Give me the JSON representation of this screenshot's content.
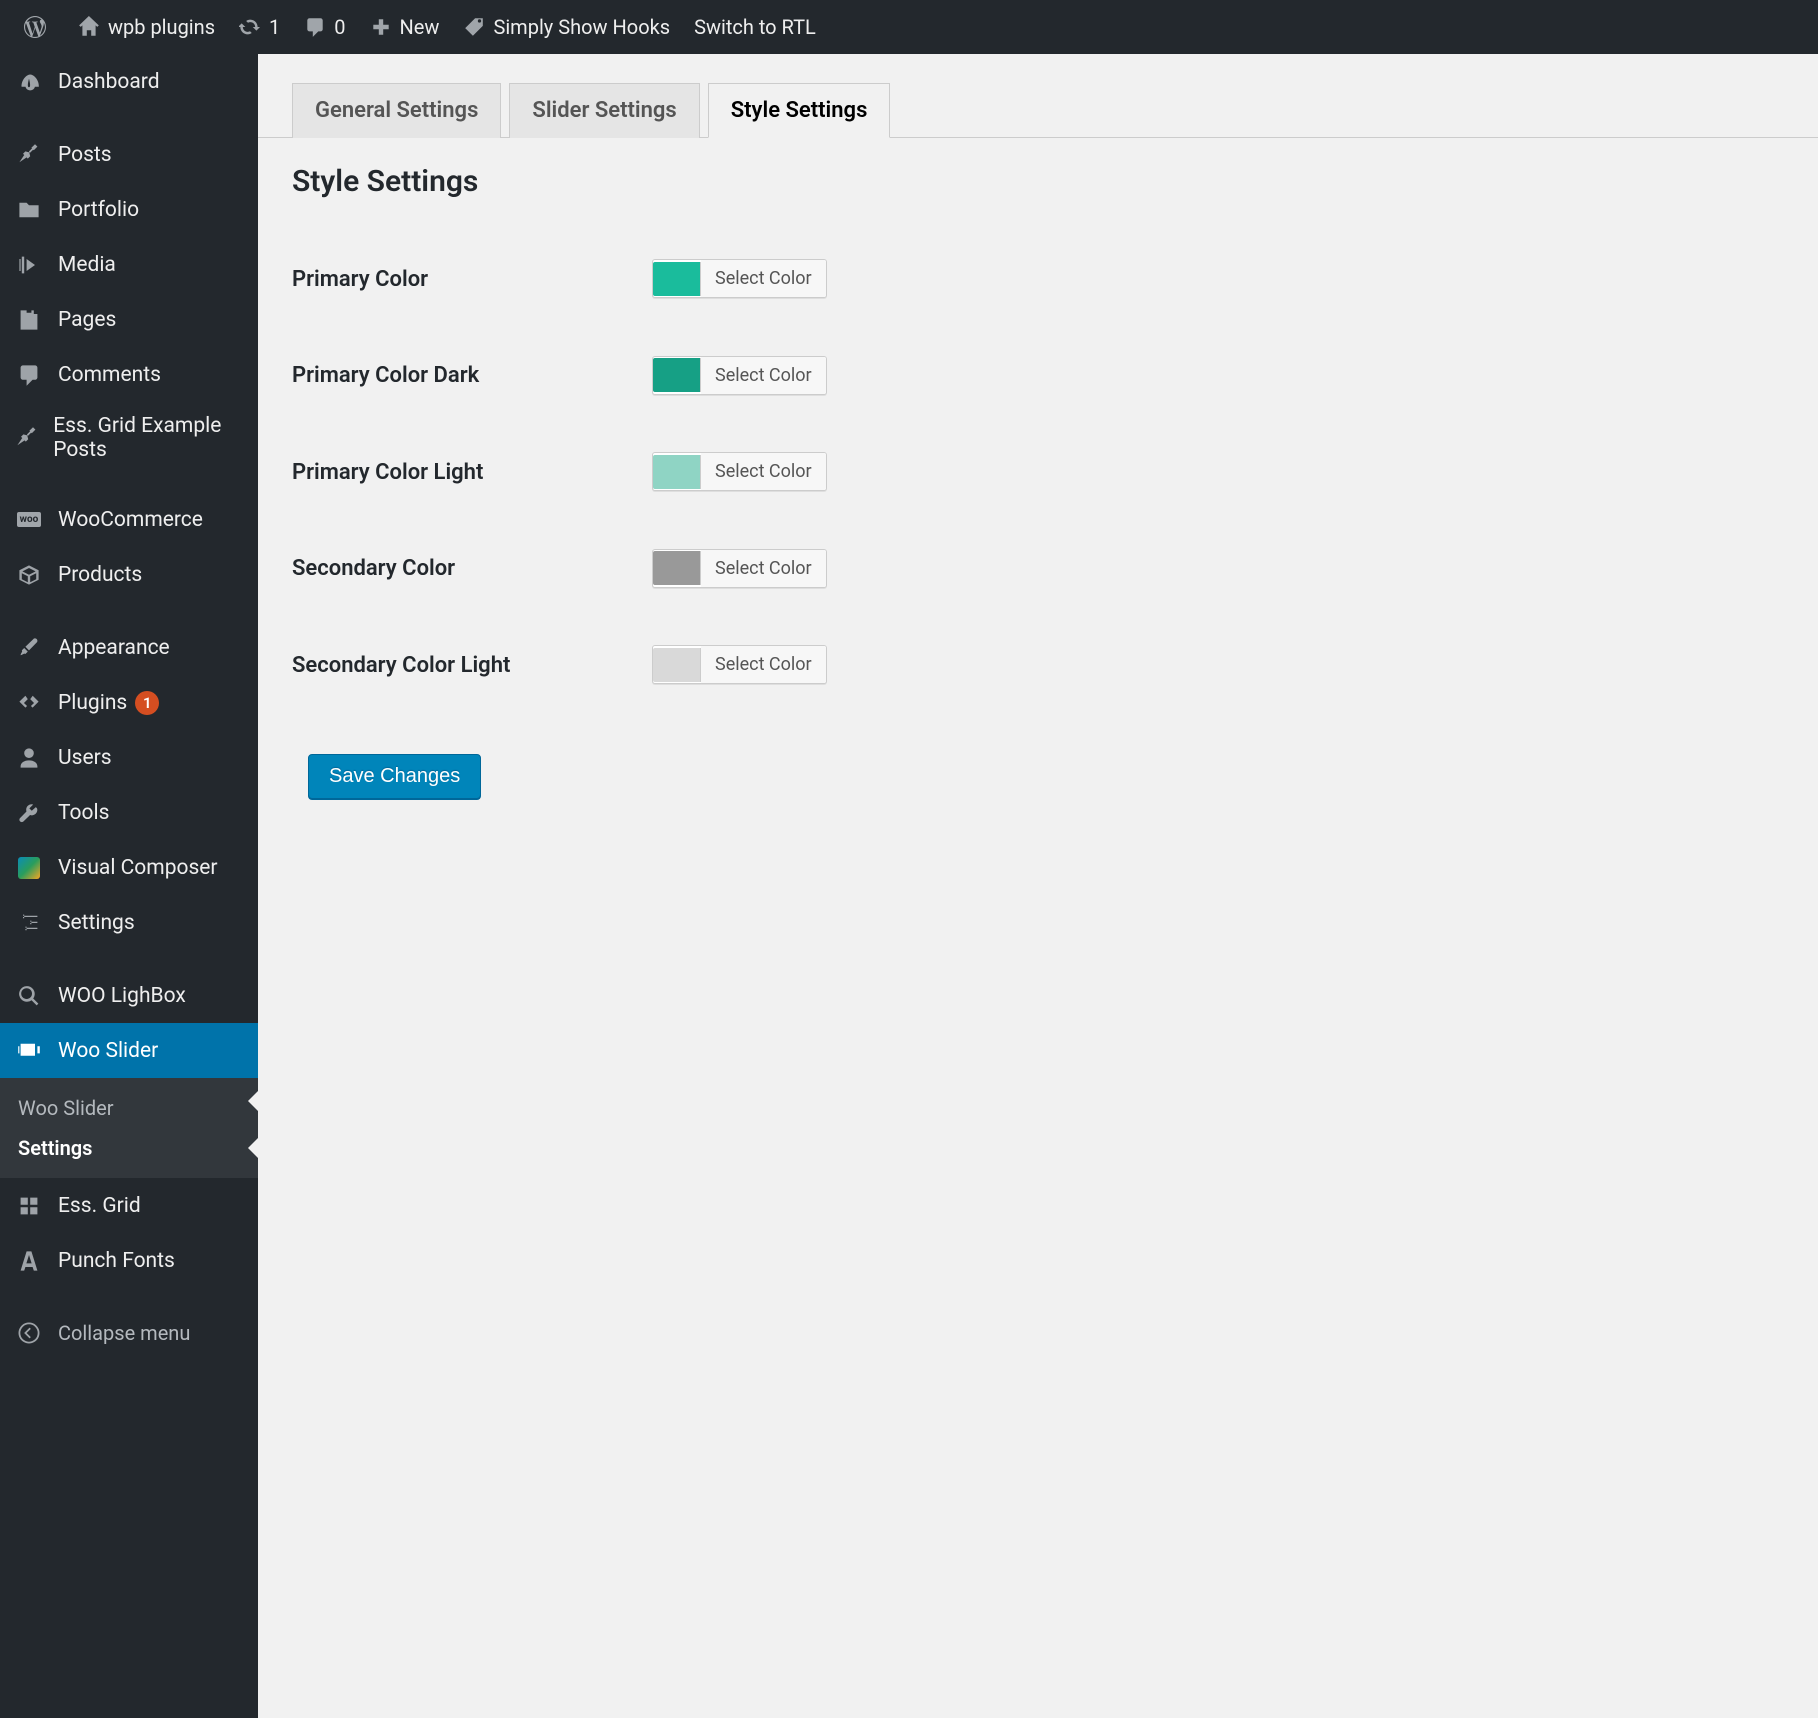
{
  "admin_bar": {
    "site_name": "wpb plugins",
    "updates_count": "1",
    "comments_count": "0",
    "new_label": "New",
    "hooks_label": "Simply Show Hooks",
    "rtl_label": "Switch to RTL"
  },
  "menu": {
    "dashboard": "Dashboard",
    "posts": "Posts",
    "portfolio": "Portfolio",
    "media": "Media",
    "pages": "Pages",
    "comments": "Comments",
    "ess_grid_posts": "Ess. Grid Example Posts",
    "woocommerce": "WooCommerce",
    "products": "Products",
    "appearance": "Appearance",
    "plugins": "Plugins",
    "plugins_badge": "1",
    "users": "Users",
    "tools": "Tools",
    "visual_composer": "Visual Composer",
    "settings": "Settings",
    "woo_lightbox": "WOO LighBox",
    "woo_slider": "Woo Slider",
    "ess_grid": "Ess. Grid",
    "punch_fonts": "Punch Fonts",
    "collapse": "Collapse menu"
  },
  "submenu": {
    "woo_slider": "Woo Slider",
    "settings": "Settings"
  },
  "tabs": {
    "general": "General Settings",
    "slider": "Slider Settings",
    "style": "Style Settings"
  },
  "page": {
    "title": "Style Settings",
    "select_color": "Select Color",
    "save_button": "Save Changes"
  },
  "fields": {
    "primary_color": {
      "label": "Primary Color",
      "color": "#1abc9c"
    },
    "primary_color_dark": {
      "label": "Primary Color Dark",
      "color": "#16a085"
    },
    "primary_color_light": {
      "label": "Primary Color Light",
      "color": "#8fd4c4"
    },
    "secondary_color": {
      "label": "Secondary Color",
      "color": "#999999"
    },
    "secondary_color_light": {
      "label": "Secondary Color Light",
      "color": "#d9d9d9"
    }
  }
}
